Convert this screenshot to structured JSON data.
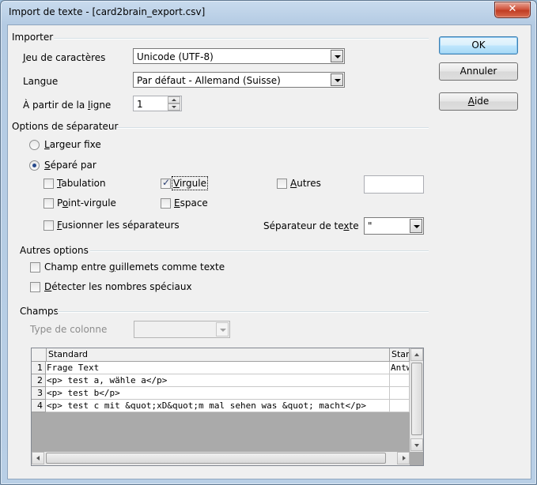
{
  "window": {
    "title": "Import de texte - [card2brain_export.csv]",
    "close_glyph": "✕"
  },
  "import": {
    "section": "Importer",
    "charset_label_u": "J",
    "charset_label": "eu de caractères",
    "charset_value": "Unicode (UTF-8)",
    "lang_label_pre": "Lan",
    "lang_label_u": "g",
    "lang_label_post": "ue",
    "lang_value": "Par défaut - Allemand (Suisse)",
    "from_line_pre": "À partir de la ",
    "from_line_u": "l",
    "from_line_post": "igne",
    "from_line_value": "1"
  },
  "separator": {
    "section": "Options de séparateur",
    "fixed_width_u": "L",
    "fixed_width": "argeur fixe",
    "separated_by_u": "S",
    "separated_by": "éparé par",
    "tab_u": "T",
    "tab": "abulation",
    "comma_u": "V",
    "comma": "irgule",
    "other_u": "A",
    "other": "utres",
    "semicolon_pre": "P",
    "semicolon_u": "o",
    "semicolon_post": "int-virgule",
    "space_u": "E",
    "space": "space",
    "merge_u": "F",
    "merge": "usionner les séparateurs",
    "text_sep_pre": "Séparateur de te",
    "text_sep_u": "x",
    "text_sep_post": "te",
    "text_sep_value": "\""
  },
  "other_options": {
    "section": "Autres options",
    "quoted_pre": "Champ entre ",
    "quoted_u": "g",
    "quoted_post": "uillemets comme texte",
    "special_u": "D",
    "special": "étecter les nombres spéciaux"
  },
  "fields": {
    "section": "Champs",
    "col_type_label": "Type de colonne",
    "col_type_value": "",
    "columns": [
      "Standard",
      "Stan"
    ],
    "rows": [
      {
        "n": "1",
        "c1": "Frage Text",
        "c2": "Antw"
      },
      {
        "n": "2",
        "c1": "<p> test a, wähle a</p>",
        "c2": ""
      },
      {
        "n": "3",
        "c1": "<p> test b</p>",
        "c2": ""
      },
      {
        "n": "4",
        "c1": "<p> test c mit &quot;xD&quot;m mal sehen was &quot; macht</p>",
        "c2": ""
      }
    ]
  },
  "buttons": {
    "ok": "OK",
    "cancel": "Annuler",
    "help_u": "A",
    "help": "ide"
  }
}
